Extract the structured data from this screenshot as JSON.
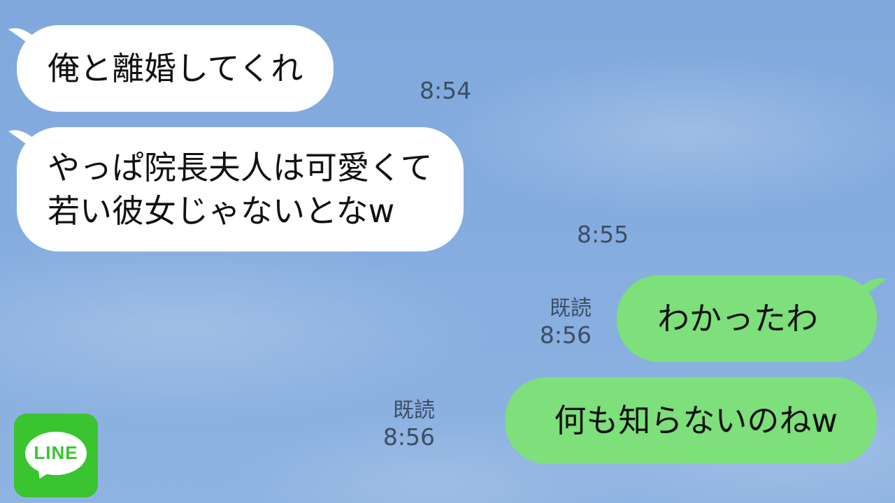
{
  "chat": {
    "messages": [
      {
        "side": "received",
        "lines": [
          "俺と離婚してくれ"
        ],
        "time": "8:54"
      },
      {
        "side": "received",
        "lines": [
          "やっぱ院長夫人は可愛くて",
          "若い彼女じゃないとなw"
        ],
        "time": "8:55"
      },
      {
        "side": "sent",
        "lines": [
          "わかったわ"
        ],
        "read_label": "既読",
        "time": "8:56"
      },
      {
        "side": "sent",
        "lines": [
          "何も知らないのねw"
        ],
        "read_label": "既読",
        "time": "8:56"
      }
    ]
  },
  "logo": {
    "text": "LINE",
    "color": "#3ac42f"
  },
  "colors": {
    "background": "#86addf",
    "received_bubble": "#ffffff",
    "sent_bubble": "#7de07a",
    "meta_text": "#3d4e63"
  },
  "icons": {
    "app_logo": "line-app-icon"
  }
}
